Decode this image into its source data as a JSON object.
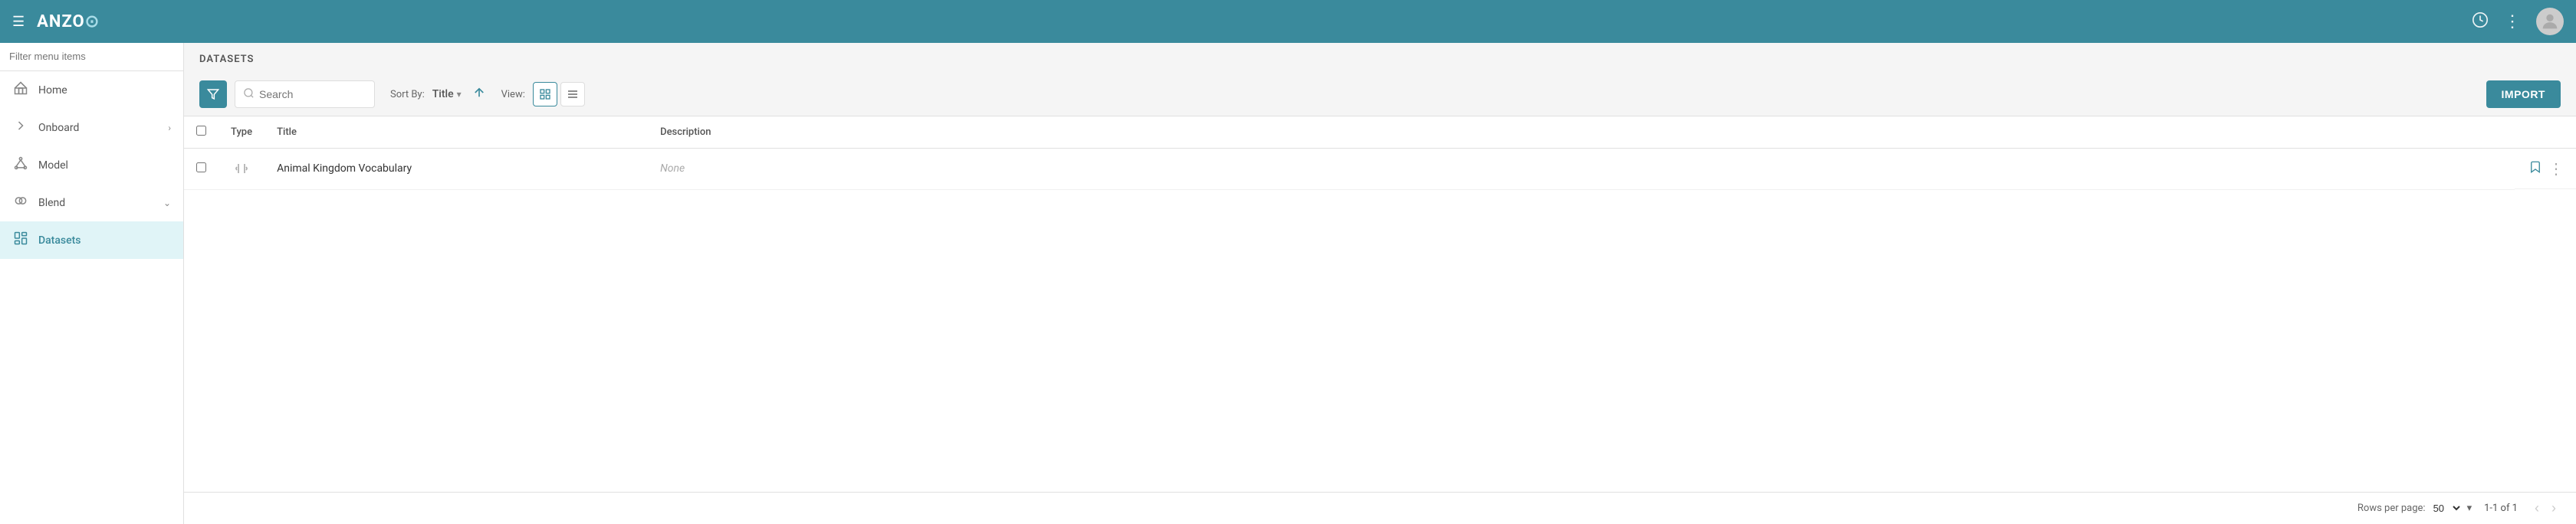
{
  "header": {
    "logo_text": "ANZQ",
    "logo_symbol": "⊙",
    "history_icon": "🕐",
    "more_icon": "⋮",
    "hamburger_icon": "☰"
  },
  "sidebar": {
    "filter_placeholder": "Filter menu items",
    "items": [
      {
        "id": "home",
        "label": "Home",
        "icon": "⌂",
        "has_chevron": false,
        "active": false
      },
      {
        "id": "onboard",
        "label": "Onboard",
        "icon": "➤",
        "has_chevron": true,
        "active": false
      },
      {
        "id": "model",
        "label": "Model",
        "icon": "✦",
        "has_chevron": false,
        "active": false
      },
      {
        "id": "blend",
        "label": "Blend",
        "icon": "✸",
        "has_chevron": true,
        "active": false
      },
      {
        "id": "datasets",
        "label": "Datasets",
        "icon": "📋",
        "has_chevron": false,
        "active": true
      }
    ]
  },
  "main": {
    "page_title": "DATASETS",
    "toolbar": {
      "search_placeholder": "Search",
      "sort_by_label": "Sort By:",
      "sort_field": "Title",
      "view_label": "View:",
      "import_label": "IMPORT"
    },
    "table": {
      "headers": [
        "",
        "Type",
        "Title",
        "Description",
        ""
      ],
      "rows": [
        {
          "id": 1,
          "type": "dataset",
          "title": "Animal Kingdom Vocabulary",
          "description": "None"
        }
      ]
    },
    "pagination": {
      "rows_per_page_label": "Rows per page:",
      "rows_per_page_value": "50",
      "page_info": "1-1 of 1"
    }
  }
}
